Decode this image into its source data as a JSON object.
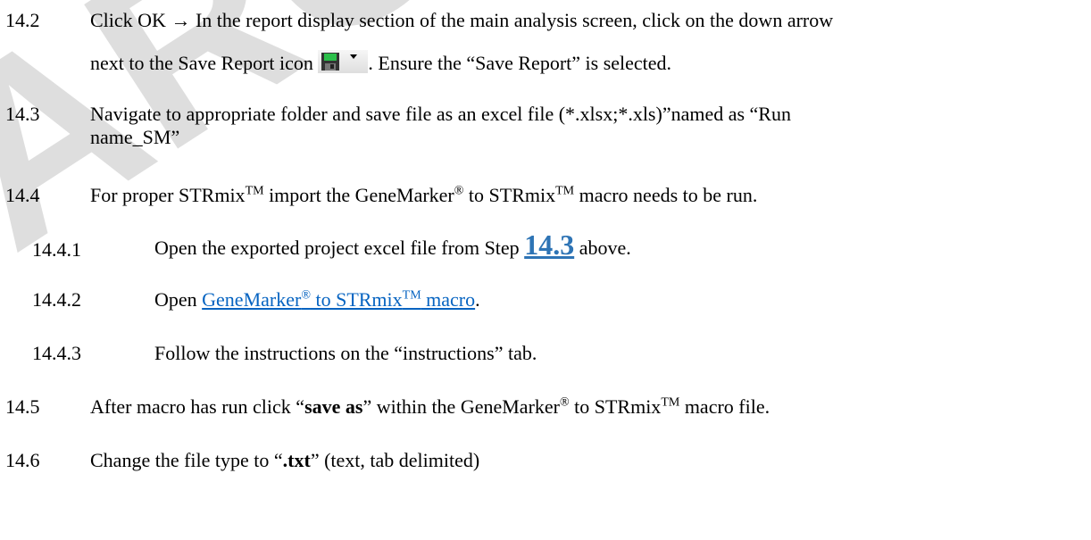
{
  "watermark": "ARCHIVED",
  "steps": {
    "s14_2": {
      "num": "14.2",
      "line1_a": "Click OK ",
      "arrow": "→",
      "line1_b": " In the report display section of the main analysis screen, click on the down arrow",
      "line2_a": "next to the Save Report icon ",
      "line2_b": ". Ensure the “Save Report” is selected.",
      "icon_name": "save-report-icon"
    },
    "s14_3": {
      "num": "14.3",
      "line1": "Navigate to appropriate folder and save file as an excel file (*.xlsx;*.xls)”named as  “Run",
      "line2": "name_SM”"
    },
    "s14_4": {
      "num": "14.4",
      "a": "For proper STRmix",
      "tm1": "TM",
      "b": " import the GeneMarker",
      "reg": "®",
      "c": " to STRmix",
      "tm2": "TM",
      "d": " macro needs to be run."
    },
    "s14_4_1": {
      "num": "14.4.1",
      "a": "Open the exported project excel file from Step ",
      "ref": "14.3",
      "b": " above."
    },
    "s14_4_2": {
      "num": "14.4.2",
      "a": "Open ",
      "link_a": "GeneMarker",
      "link_reg": "®",
      "link_b": " to STRmix",
      "link_tm": "TM",
      "link_c": " macro",
      "b": "."
    },
    "s14_4_3": {
      "num": "14.4.3",
      "text": "Follow the instructions on the “instructions” tab."
    },
    "s14_5": {
      "num": "14.5",
      "a": "After macro has run click “",
      "bold": "save as",
      "b": "” within the GeneMarker",
      "reg": "®",
      "c": " to STRmix",
      "tm": "TM",
      "d": " macro file."
    },
    "s14_6": {
      "num": "14.6",
      "a": "Change the file type to “",
      "bold": ".txt",
      "b": "” (text, tab delimited)"
    }
  },
  "colors": {
    "link": "#0563c1",
    "ref": "#2e74b5"
  }
}
